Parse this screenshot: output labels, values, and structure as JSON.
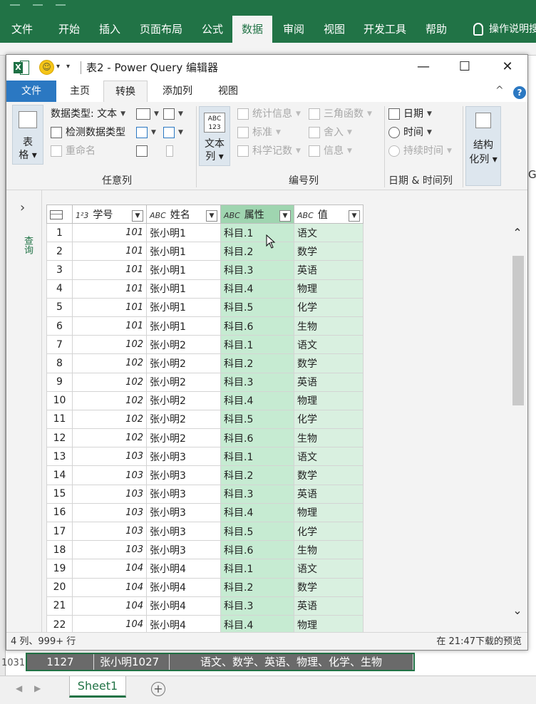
{
  "excel": {
    "tabs": [
      "文件",
      "开始",
      "插入",
      "页面布局",
      "公式",
      "数据",
      "审阅",
      "视图",
      "开发工具",
      "帮助"
    ],
    "active_tab": "数据",
    "tell_me": "操作说明搜",
    "row_label": "1031",
    "row_cells": [
      "1127",
      "张小明1027",
      "语文、数学、英语、物理、化学、生物"
    ],
    "sheet_tab": "Sheet1",
    "add_sheet": "+",
    "right_edge_letter": "G"
  },
  "pq": {
    "title": "表2 - Power Query 编辑器",
    "win_min": "—",
    "win_max": "☐",
    "win_close": "✕",
    "tabs": [
      "文件",
      "主页",
      "转换",
      "添加列",
      "视图"
    ],
    "active_tab": "转换",
    "help": "?",
    "collapse": "^",
    "ribbon": {
      "table_btn": "表格",
      "table_btn_line1": "表",
      "table_btn_line2": "格 ▾",
      "data_type": "数据类型: 文本",
      "detect_type": "检测数据类型",
      "rename": "重命名",
      "group_any": "任意列",
      "text_col_line1": "文本",
      "text_col_line2": "列 ▾",
      "stats": "统计信息",
      "standard": "标准",
      "sci": "科学记数",
      "trig": "三角函数",
      "round": "舍入",
      "info": "信息",
      "group_num": "编号列",
      "date": "日期",
      "time": "时间",
      "duration": "持续时间",
      "group_dt": "日期 & 时间列",
      "struct_line1": "结构",
      "struct_line2": "化列 ▾"
    },
    "nav_label": "查询",
    "columns": [
      {
        "type": "1²3",
        "name": "学号"
      },
      {
        "type": "ABC",
        "name": "姓名"
      },
      {
        "type": "ABC",
        "name": "属性"
      },
      {
        "type": "ABC",
        "name": "值"
      }
    ],
    "rows": [
      [
        "1",
        "101",
        "张小明1",
        "科目.1",
        "语文"
      ],
      [
        "2",
        "101",
        "张小明1",
        "科目.2",
        "数学"
      ],
      [
        "3",
        "101",
        "张小明1",
        "科目.3",
        "英语"
      ],
      [
        "4",
        "101",
        "张小明1",
        "科目.4",
        "物理"
      ],
      [
        "5",
        "101",
        "张小明1",
        "科目.5",
        "化学"
      ],
      [
        "6",
        "101",
        "张小明1",
        "科目.6",
        "生物"
      ],
      [
        "7",
        "102",
        "张小明2",
        "科目.1",
        "语文"
      ],
      [
        "8",
        "102",
        "张小明2",
        "科目.2",
        "数学"
      ],
      [
        "9",
        "102",
        "张小明2",
        "科目.3",
        "英语"
      ],
      [
        "10",
        "102",
        "张小明2",
        "科目.4",
        "物理"
      ],
      [
        "11",
        "102",
        "张小明2",
        "科目.5",
        "化学"
      ],
      [
        "12",
        "102",
        "张小明2",
        "科目.6",
        "生物"
      ],
      [
        "13",
        "103",
        "张小明3",
        "科目.1",
        "语文"
      ],
      [
        "14",
        "103",
        "张小明3",
        "科目.2",
        "数学"
      ],
      [
        "15",
        "103",
        "张小明3",
        "科目.3",
        "英语"
      ],
      [
        "16",
        "103",
        "张小明3",
        "科目.4",
        "物理"
      ],
      [
        "17",
        "103",
        "张小明3",
        "科目.5",
        "化学"
      ],
      [
        "18",
        "103",
        "张小明3",
        "科目.6",
        "生物"
      ],
      [
        "19",
        "104",
        "张小明4",
        "科目.1",
        "语文"
      ],
      [
        "20",
        "104",
        "张小明4",
        "科目.2",
        "数学"
      ],
      [
        "21",
        "104",
        "张小明4",
        "科目.3",
        "英语"
      ],
      [
        "22",
        "104",
        "张小明4",
        "科目.4",
        "物理"
      ]
    ],
    "status_left": "4 列、999+ 行",
    "status_right": "在 21:47下载的预览"
  },
  "colors": {
    "excel_green": "#217346",
    "pq_blue": "#2b78c2",
    "selected_header": "#9fd5b0",
    "selected_col": "#c6ebd2"
  }
}
